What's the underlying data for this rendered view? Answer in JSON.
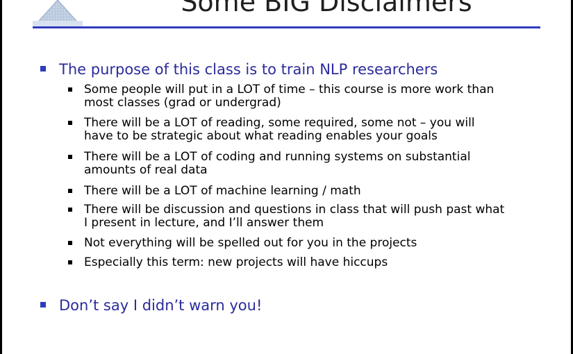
{
  "slide": {
    "title": "Some BIG Disclaimers",
    "bullets": [
      {
        "text": "The purpose of this class is to train NLP researchers",
        "sub": [
          "Some people will put in a LOT of time – this course is more work than\nmost classes (grad or undergrad)",
          "There will be a LOT of reading, some required, some not – you will\nhave to be strategic about what reading enables your goals",
          "There will be a LOT of coding and running systems on substantial\namounts of real data",
          "There will be a LOT of machine learning / math",
          "There will be discussion and questions in class that will push past what\nI present in lecture, and I’ll answer them",
          "Not everything will be spelled out for you in the projects",
          "Especially this term: new projects will have hiccups"
        ]
      },
      {
        "text": "Don’t say I didn’t warn you!",
        "sub": []
      }
    ]
  },
  "colors": {
    "accent": "#2f3bbd",
    "level1_text": "#2b2b9c"
  }
}
